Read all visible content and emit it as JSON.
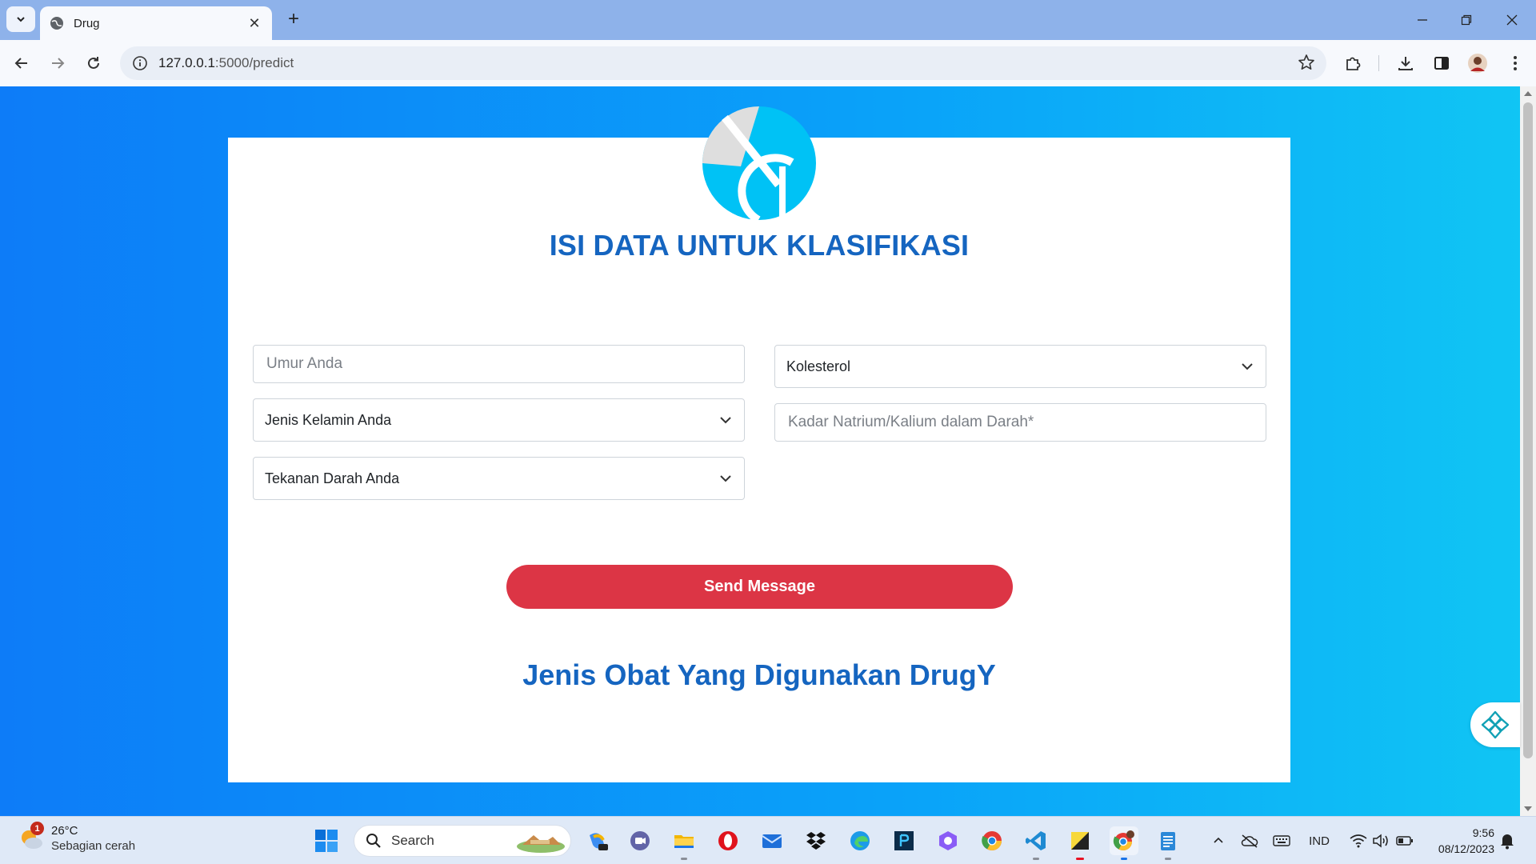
{
  "browser": {
    "tab_title": "Drug",
    "url_host": "127.0.0.1",
    "url_path": ":5000/predict"
  },
  "form": {
    "title": "ISI DATA UNTUK KLASIFIKASI",
    "age_placeholder": "Umur Anda",
    "sex_select": "Jenis Kelamin Anda",
    "bp_select": "Tekanan Darah Anda",
    "cholesterol_select": "Kolesterol",
    "na_to_k_placeholder": "Kadar Natrium/Kalium dalam Darah*",
    "submit_label": "Send Message",
    "result_text": "Jenis Obat Yang Digunakan DrugY"
  },
  "colors": {
    "accent_blue": "#1565c0",
    "button_red": "#dc3545",
    "background_gradient_start": "#0d7cf8",
    "background_gradient_end": "#10c5f4"
  },
  "taskbar": {
    "weather_temp": "26°C",
    "weather_condition": "Sebagian cerah",
    "weather_badge": "1",
    "search_label": "Search",
    "language": "IND",
    "time": "9:56",
    "date": "08/12/2023"
  }
}
